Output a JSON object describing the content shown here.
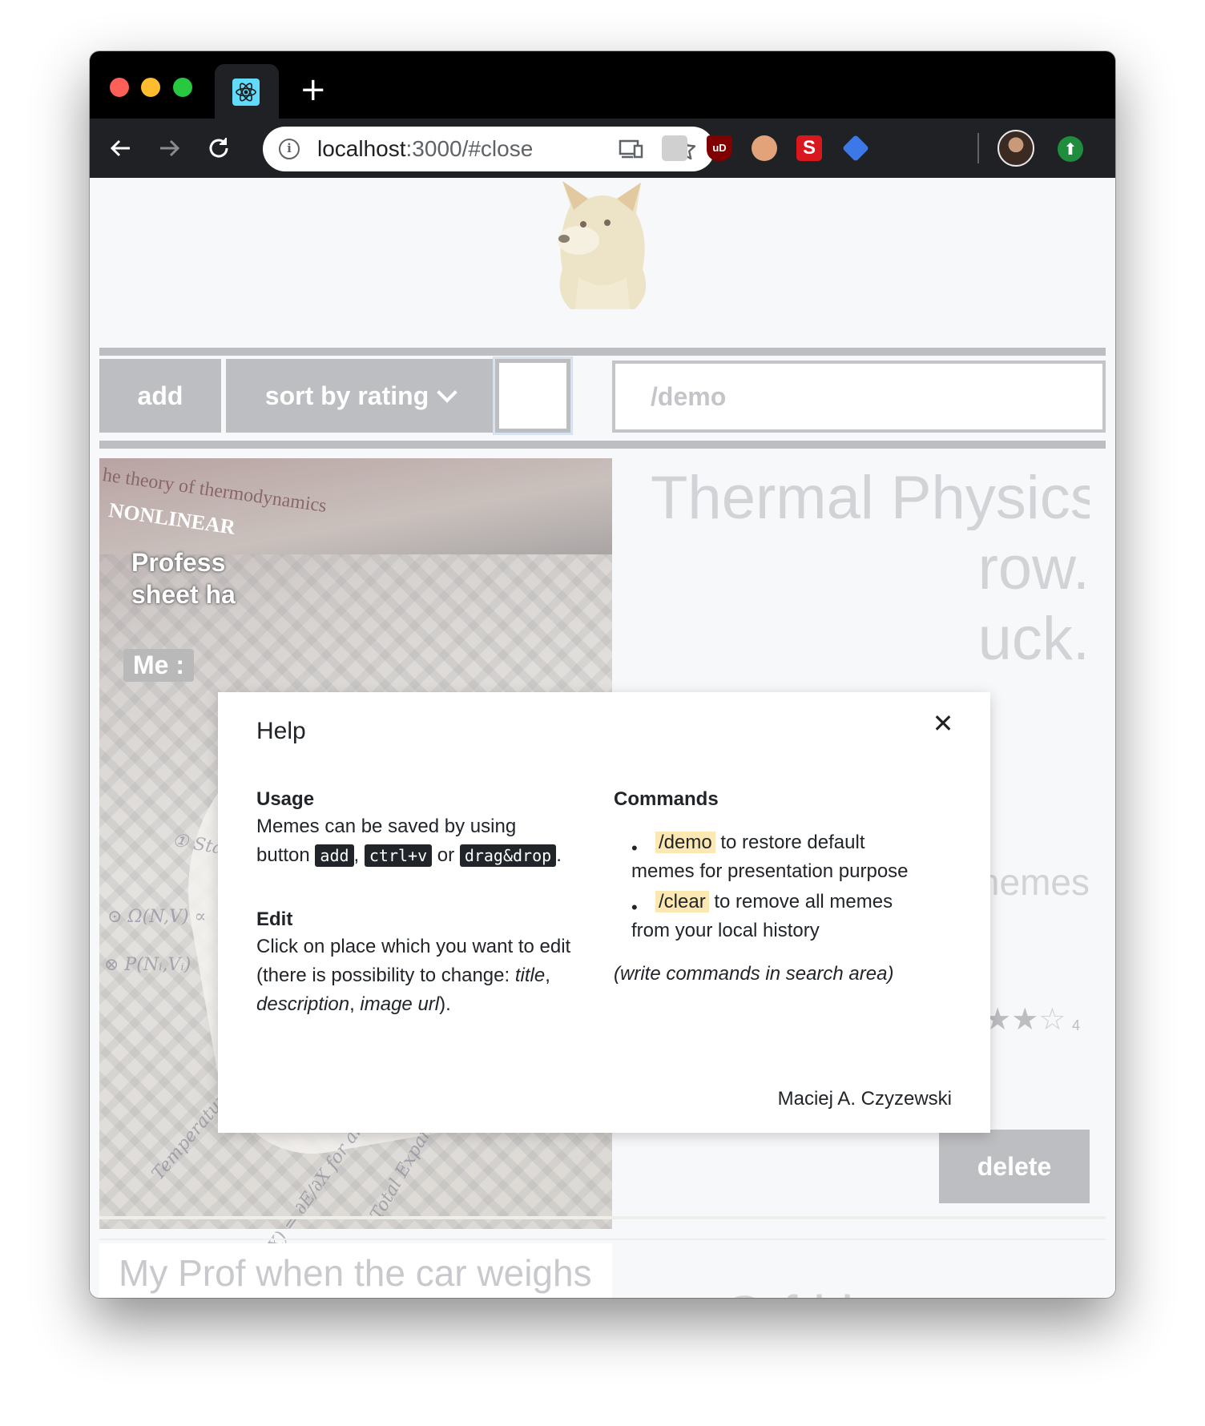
{
  "browser": {
    "url_host": "localhost",
    "url_path": ":3000/#close",
    "tab_favicon": "react-icon",
    "extensions": [
      "briefcase-icon",
      "ublock-icon",
      "glasses-icon",
      "s-extension-icon",
      "graduation-cap-icon"
    ]
  },
  "app": {
    "add_label": "add",
    "sort_label": "sort by rating",
    "search_value": "/demo"
  },
  "meme": {
    "image_caption_1": "Profess",
    "image_caption_2": "sheet ha",
    "image_me_tag": "Me :",
    "book_text": "he theory of thermodynamics",
    "book_text_2": "NONLINEAR",
    "title_line_1": "Thermal Physics",
    "title_line_2": "row.",
    "title_line_3": "uck.",
    "description_fragment": "nemes",
    "rating": 4,
    "rating_max": 5,
    "rating_label": "4",
    "delete_label": "delete"
  },
  "next_meme": {
    "title": "My Prof when the car weighs"
  },
  "help_modal": {
    "title": "Help",
    "usage_heading": "Usage",
    "usage_text_1": "Memes can be saved by using",
    "usage_text_2": "button",
    "usage_key_add": "add",
    "usage_key_ctrlv": "ctrl+v",
    "usage_or": "or",
    "usage_key_drag": "drag&drop",
    "edit_heading": "Edit",
    "edit_text_1": "Click on place which you want to edit",
    "edit_text_2": "(there is possibility to change:",
    "edit_term_title": "title",
    "edit_term_description": "description",
    "edit_term_image": "image url",
    "commands_heading": "Commands",
    "cmd_demo": "/demo",
    "cmd_demo_text_1": "to restore default",
    "cmd_demo_text_2": "memes for presentation purpose",
    "cmd_clear": "/clear",
    "cmd_clear_text_1": "to remove all memes",
    "cmd_clear_text_2": "from your local history",
    "commands_note": "(write commands in search area)",
    "author": "Maciej A. Czyzewski"
  }
}
